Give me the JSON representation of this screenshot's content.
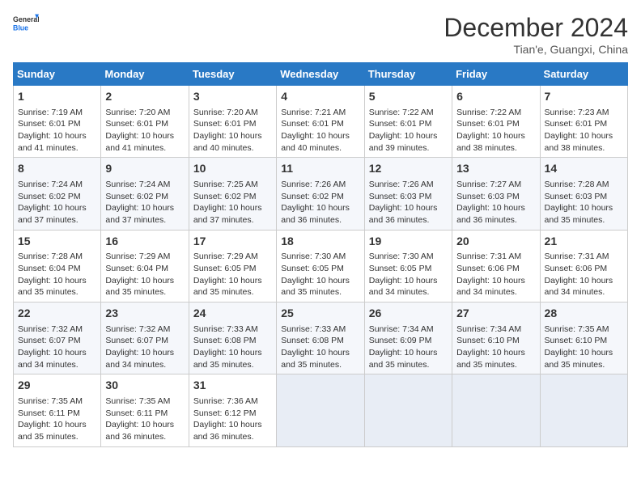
{
  "header": {
    "logo_line1": "General",
    "logo_line2": "Blue",
    "month": "December 2024",
    "location": "Tian'e, Guangxi, China"
  },
  "days_of_week": [
    "Sunday",
    "Monday",
    "Tuesday",
    "Wednesday",
    "Thursday",
    "Friday",
    "Saturday"
  ],
  "weeks": [
    [
      {
        "num": "1",
        "lines": [
          "Sunrise: 7:19 AM",
          "Sunset: 6:01 PM",
          "Daylight: 10 hours",
          "and 41 minutes."
        ]
      },
      {
        "num": "2",
        "lines": [
          "Sunrise: 7:20 AM",
          "Sunset: 6:01 PM",
          "Daylight: 10 hours",
          "and 41 minutes."
        ]
      },
      {
        "num": "3",
        "lines": [
          "Sunrise: 7:20 AM",
          "Sunset: 6:01 PM",
          "Daylight: 10 hours",
          "and 40 minutes."
        ]
      },
      {
        "num": "4",
        "lines": [
          "Sunrise: 7:21 AM",
          "Sunset: 6:01 PM",
          "Daylight: 10 hours",
          "and 40 minutes."
        ]
      },
      {
        "num": "5",
        "lines": [
          "Sunrise: 7:22 AM",
          "Sunset: 6:01 PM",
          "Daylight: 10 hours",
          "and 39 minutes."
        ]
      },
      {
        "num": "6",
        "lines": [
          "Sunrise: 7:22 AM",
          "Sunset: 6:01 PM",
          "Daylight: 10 hours",
          "and 38 minutes."
        ]
      },
      {
        "num": "7",
        "lines": [
          "Sunrise: 7:23 AM",
          "Sunset: 6:01 PM",
          "Daylight: 10 hours",
          "and 38 minutes."
        ]
      }
    ],
    [
      {
        "num": "8",
        "lines": [
          "Sunrise: 7:24 AM",
          "Sunset: 6:02 PM",
          "Daylight: 10 hours",
          "and 37 minutes."
        ]
      },
      {
        "num": "9",
        "lines": [
          "Sunrise: 7:24 AM",
          "Sunset: 6:02 PM",
          "Daylight: 10 hours",
          "and 37 minutes."
        ]
      },
      {
        "num": "10",
        "lines": [
          "Sunrise: 7:25 AM",
          "Sunset: 6:02 PM",
          "Daylight: 10 hours",
          "and 37 minutes."
        ]
      },
      {
        "num": "11",
        "lines": [
          "Sunrise: 7:26 AM",
          "Sunset: 6:02 PM",
          "Daylight: 10 hours",
          "and 36 minutes."
        ]
      },
      {
        "num": "12",
        "lines": [
          "Sunrise: 7:26 AM",
          "Sunset: 6:03 PM",
          "Daylight: 10 hours",
          "and 36 minutes."
        ]
      },
      {
        "num": "13",
        "lines": [
          "Sunrise: 7:27 AM",
          "Sunset: 6:03 PM",
          "Daylight: 10 hours",
          "and 36 minutes."
        ]
      },
      {
        "num": "14",
        "lines": [
          "Sunrise: 7:28 AM",
          "Sunset: 6:03 PM",
          "Daylight: 10 hours",
          "and 35 minutes."
        ]
      }
    ],
    [
      {
        "num": "15",
        "lines": [
          "Sunrise: 7:28 AM",
          "Sunset: 6:04 PM",
          "Daylight: 10 hours",
          "and 35 minutes."
        ]
      },
      {
        "num": "16",
        "lines": [
          "Sunrise: 7:29 AM",
          "Sunset: 6:04 PM",
          "Daylight: 10 hours",
          "and 35 minutes."
        ]
      },
      {
        "num": "17",
        "lines": [
          "Sunrise: 7:29 AM",
          "Sunset: 6:05 PM",
          "Daylight: 10 hours",
          "and 35 minutes."
        ]
      },
      {
        "num": "18",
        "lines": [
          "Sunrise: 7:30 AM",
          "Sunset: 6:05 PM",
          "Daylight: 10 hours",
          "and 35 minutes."
        ]
      },
      {
        "num": "19",
        "lines": [
          "Sunrise: 7:30 AM",
          "Sunset: 6:05 PM",
          "Daylight: 10 hours",
          "and 34 minutes."
        ]
      },
      {
        "num": "20",
        "lines": [
          "Sunrise: 7:31 AM",
          "Sunset: 6:06 PM",
          "Daylight: 10 hours",
          "and 34 minutes."
        ]
      },
      {
        "num": "21",
        "lines": [
          "Sunrise: 7:31 AM",
          "Sunset: 6:06 PM",
          "Daylight: 10 hours",
          "and 34 minutes."
        ]
      }
    ],
    [
      {
        "num": "22",
        "lines": [
          "Sunrise: 7:32 AM",
          "Sunset: 6:07 PM",
          "Daylight: 10 hours",
          "and 34 minutes."
        ]
      },
      {
        "num": "23",
        "lines": [
          "Sunrise: 7:32 AM",
          "Sunset: 6:07 PM",
          "Daylight: 10 hours",
          "and 34 minutes."
        ]
      },
      {
        "num": "24",
        "lines": [
          "Sunrise: 7:33 AM",
          "Sunset: 6:08 PM",
          "Daylight: 10 hours",
          "and 35 minutes."
        ]
      },
      {
        "num": "25",
        "lines": [
          "Sunrise: 7:33 AM",
          "Sunset: 6:08 PM",
          "Daylight: 10 hours",
          "and 35 minutes."
        ]
      },
      {
        "num": "26",
        "lines": [
          "Sunrise: 7:34 AM",
          "Sunset: 6:09 PM",
          "Daylight: 10 hours",
          "and 35 minutes."
        ]
      },
      {
        "num": "27",
        "lines": [
          "Sunrise: 7:34 AM",
          "Sunset: 6:10 PM",
          "Daylight: 10 hours",
          "and 35 minutes."
        ]
      },
      {
        "num": "28",
        "lines": [
          "Sunrise: 7:35 AM",
          "Sunset: 6:10 PM",
          "Daylight: 10 hours",
          "and 35 minutes."
        ]
      }
    ],
    [
      {
        "num": "29",
        "lines": [
          "Sunrise: 7:35 AM",
          "Sunset: 6:11 PM",
          "Daylight: 10 hours",
          "and 35 minutes."
        ]
      },
      {
        "num": "30",
        "lines": [
          "Sunrise: 7:35 AM",
          "Sunset: 6:11 PM",
          "Daylight: 10 hours",
          "and 36 minutes."
        ]
      },
      {
        "num": "31",
        "lines": [
          "Sunrise: 7:36 AM",
          "Sunset: 6:12 PM",
          "Daylight: 10 hours",
          "and 36 minutes."
        ]
      },
      {
        "num": "",
        "lines": []
      },
      {
        "num": "",
        "lines": []
      },
      {
        "num": "",
        "lines": []
      },
      {
        "num": "",
        "lines": []
      }
    ]
  ]
}
